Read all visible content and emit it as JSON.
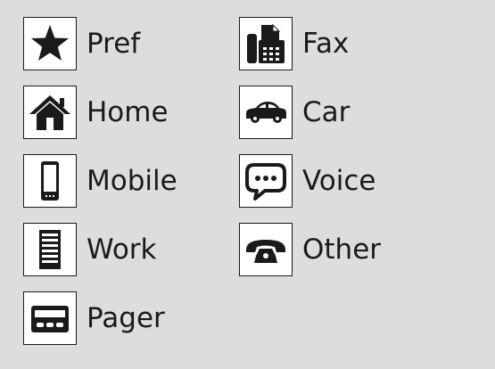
{
  "accent_color": "#1a1a1a",
  "background_color": "#dcdddd",
  "phone_types": {
    "left": [
      {
        "label": "Pref",
        "icon": "star-icon"
      },
      {
        "label": "Home",
        "icon": "house-icon"
      },
      {
        "label": "Mobile",
        "icon": "mobile-phone-icon"
      },
      {
        "label": "Work",
        "icon": "office-building-icon"
      },
      {
        "label": "Pager",
        "icon": "pager-icon"
      }
    ],
    "right": [
      {
        "label": "Fax",
        "icon": "fax-machine-icon"
      },
      {
        "label": "Car",
        "icon": "car-icon"
      },
      {
        "label": "Voice",
        "icon": "speech-bubble-icon"
      },
      {
        "label": "Other",
        "icon": "telephone-handset-icon"
      }
    ]
  }
}
